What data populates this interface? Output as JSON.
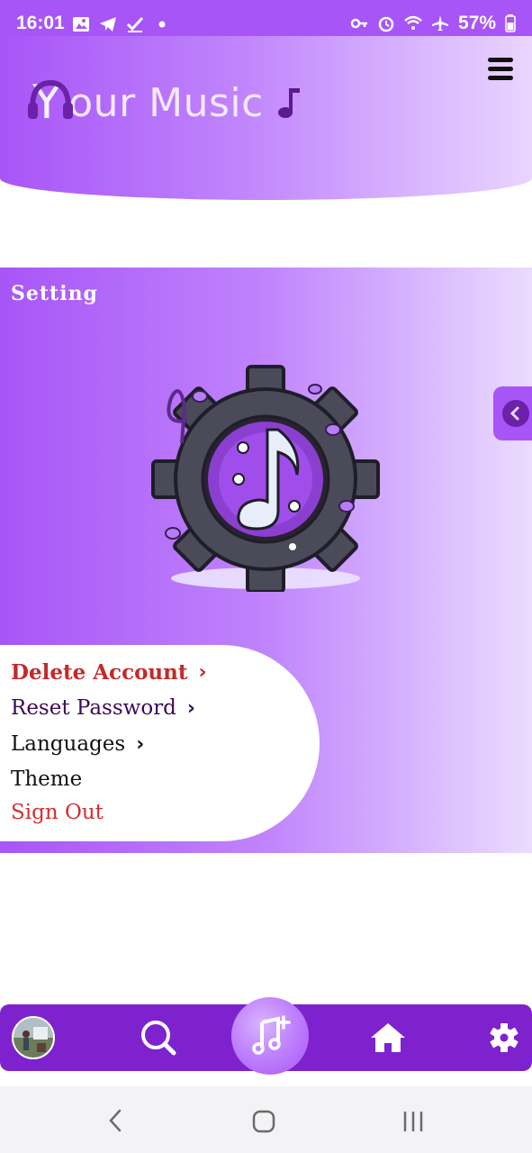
{
  "status_bar": {
    "time": "16:01",
    "battery": "57%",
    "left_icons": [
      "image-icon",
      "telegram-icon",
      "checkmark-icon",
      "dot-icon"
    ],
    "right_icons": [
      "key-icon",
      "alarm-icon",
      "wifi-icon",
      "airplane-icon",
      "battery-icon"
    ]
  },
  "header": {
    "logo_first_letter": "Y",
    "logo_rest": "our Music",
    "logo_icon": "headphones-icon",
    "note_icon": "music-note-icon",
    "menu_icon": "hamburger-menu-icon"
  },
  "settings_panel": {
    "title": "Setting",
    "illustration": "gear-music-note-illustration",
    "side_toggle_icon": "chevron-left-icon"
  },
  "menu": {
    "items": [
      {
        "label": "Delete Account",
        "color": "#c62828",
        "chevron": "›"
      },
      {
        "label": "Reset Password",
        "color": "#3b0a57",
        "chevron": "›"
      },
      {
        "label": "Languages",
        "color": "#111111",
        "chevron": "›"
      },
      {
        "label": "Theme",
        "color": "#111111",
        "chevron": ""
      },
      {
        "label": "Sign Out",
        "color": "#d32f2f",
        "chevron": ""
      }
    ]
  },
  "bottom_nav": {
    "items": [
      {
        "name": "profile-avatar"
      },
      {
        "name": "search-icon"
      },
      {
        "name": "add-music-icon"
      },
      {
        "name": "home-icon"
      },
      {
        "name": "settings-gear-icon"
      }
    ]
  },
  "system_nav": {
    "items": [
      "back-icon",
      "home-button-icon",
      "recent-apps-icon"
    ]
  },
  "colors": {
    "primary": "#a855f7",
    "nav_bg": "#7e22ce",
    "accent_light": "#e9d5ff"
  }
}
